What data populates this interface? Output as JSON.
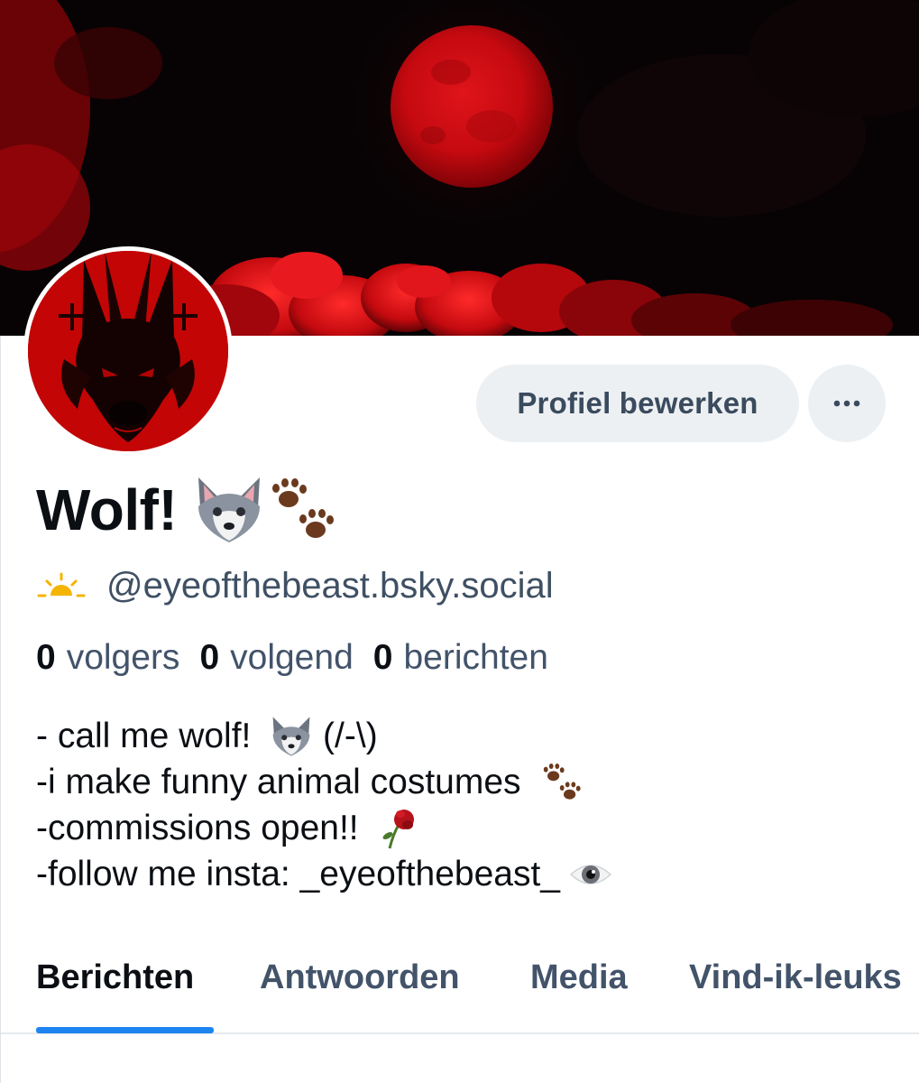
{
  "profile": {
    "display_name": "Wolf!",
    "handle": "@eyeofthebeast.bsky.social"
  },
  "actions": {
    "edit_label": "Profiel bewerken",
    "more_label": "···"
  },
  "stats": [
    {
      "count": "0",
      "label": "volgers"
    },
    {
      "count": "0",
      "label": "volgend"
    },
    {
      "count": "0",
      "label": "berichten"
    }
  ],
  "bio": [
    {
      "text": "- call me wolf! ",
      "emoji": "wolf-face-icon",
      "after": " (/-\\)"
    },
    {
      "text": "-i make funny animal costumes ",
      "emoji": "paw-prints-icon",
      "after": ""
    },
    {
      "text": "-commissions open!! ",
      "emoji": "wilted-rose-icon",
      "after": ""
    },
    {
      "text": "-follow me insta: _eyeofthebeast_",
      "emoji": "eye-icon",
      "after": ""
    }
  ],
  "tabs": [
    {
      "label": "Berichten",
      "active": true
    },
    {
      "label": "Antwoorden",
      "active": false
    },
    {
      "label": "Media",
      "active": false
    },
    {
      "label": "Vind-ik-leuks",
      "active": false
    }
  ],
  "colors": {
    "accent": "#1d84f0",
    "button_bg": "#edf0f3",
    "text_primary": "#0b0f14",
    "text_secondary": "#42536a",
    "avatar_bg": "#c30505"
  }
}
